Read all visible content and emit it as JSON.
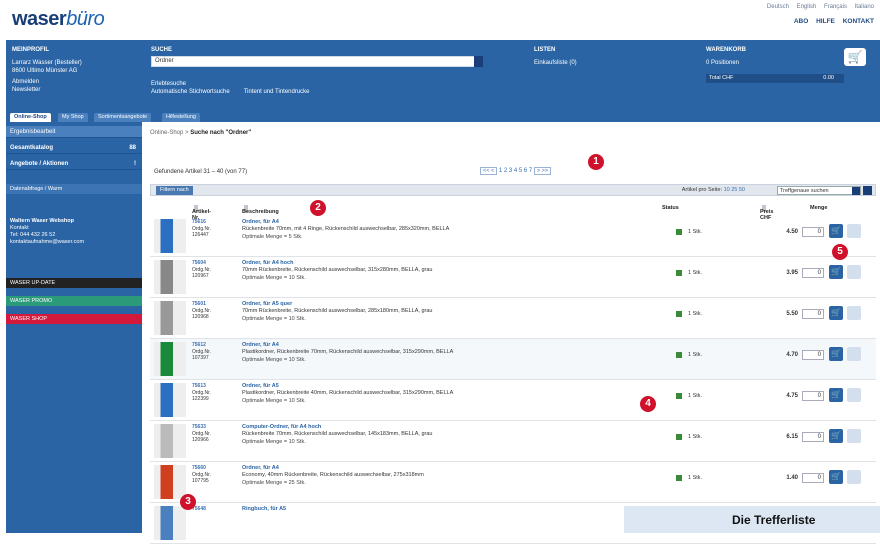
{
  "brand": {
    "logo_main": "waser",
    "logo_accent": "büro"
  },
  "top_links": [
    "Deutsch",
    "English",
    "Français",
    "Italiano"
  ],
  "top_nav": [
    "ABO",
    "HILFE",
    "KONTAKT"
  ],
  "banner": {
    "col1_title": "MEINPROFIL",
    "col1_lines": [
      "Larrarz Wasser (Besteller)",
      "8600 Ultimo Münster AG"
    ],
    "col1_links": [
      "Abmelden",
      "Newsletter"
    ],
    "search_title": "SUCHE",
    "search_value": "Ordner",
    "search_opts": [
      "Erlebtesuche",
      "Automatische Stichwortsuche",
      "Tintent und Tintendrucke"
    ],
    "lists_title": "LISTEN",
    "lists_item": "Einkaufsliste (0)",
    "cart_title": "WARENKORB",
    "cart_positions": "0 Positionen",
    "cart_total_label": "Total CHF",
    "cart_total_value": "0.00"
  },
  "tabs": [
    "Online-Shop",
    "My Shop",
    "Sortimentsangebote",
    "Hilfestellung"
  ],
  "sidebar": {
    "items": [
      {
        "label": "Ergebnisbearbeit",
        "right": ""
      },
      {
        "label": "Gesamtkatalog",
        "right": "88"
      },
      {
        "label": "Angebote / Aktionen",
        "right": "!"
      }
    ],
    "box1": "Datenabfrage / Warm",
    "contact_title": "Waltern Waser Webshop",
    "contact_lines": [
      "Kontakt",
      "Tel: 044 432 26 52",
      "kontaktaufnahme@waser.com"
    ],
    "bars": [
      {
        "label": "WASER UP-DATE",
        "color": "#222222"
      },
      {
        "label": "WASER PROMO",
        "color": "#2a9a78"
      },
      {
        "label": "WASER SHOP",
        "color": "#d41a3c"
      }
    ]
  },
  "breadcrumb": {
    "prefix": "Online-Shop >",
    "current": "Suche nach \"Ordner\""
  },
  "results": {
    "found": "Gefundene Artikel 31 – 40 (von 77)",
    "pages": "1 2 3 4 5 6 7",
    "per_page_label": "Artikel pro Seite:",
    "per_page_values": "10 25 50",
    "sort_value": "Treffgenaue suchen",
    "filter_button": "Filtern nach"
  },
  "columns": {
    "article": "Artikel-Nr.",
    "desc": "Beschreibung",
    "status": "Status",
    "price": "Preis CHF",
    "qty": "Menge"
  },
  "rows": [
    {
      "num": "75616",
      "unit": "Ordg.Nr.",
      "code": "126447",
      "title": "Ordner, für A4",
      "line": "Rückenbreite 70mm, mit 4 Ringe, Rückenschild auswechselbar, 285x320mm, BELLA",
      "min": "Optimale Menge = 5 Stk.",
      "stock": "1 Stk.",
      "price": "4.50",
      "qty": "0"
    },
    {
      "num": "75604",
      "unit": "Ordg.Nr.",
      "code": "120967",
      "title": "Ordner, für A4 hoch",
      "line": "70mm Rückenbreite, Rückenschild auswechselbar, 315x280mm, BELLA, grau",
      "min": "Optimale Menge = 10 Stk.",
      "stock": "1 Stk.",
      "price": "3.95",
      "qty": "0"
    },
    {
      "num": "75601",
      "unit": "Ordg.Nr.",
      "code": "120968",
      "title": "Ordner, für A5 quer",
      "line": "70mm Rückenbreite, Rückenschild auswechselbar, 285x180mm, BELLA, grau",
      "min": "Optimale Menge = 10 Stk.",
      "stock": "1 Stk.",
      "price": "5.50",
      "qty": "0"
    },
    {
      "num": "75612",
      "unit": "Ordg.Nr.",
      "code": "107397",
      "title": "Ordner, für A4",
      "line": "Plastikordner, Rückenbreite 70mm, Rückenschild auswechselbar, 315x290mm, BELLA",
      "min": "Optimale Menge = 10 Stk.",
      "stock": "1 Stk.",
      "price": "4.70",
      "qty": "0"
    },
    {
      "num": "75613",
      "unit": "Ordg.Nr.",
      "code": "122399",
      "title": "Ordner, für A5",
      "line": "Plastikordner, Rückenbreite 40mm, Rückenschild auswechselbar, 315x290mm, BELLA",
      "min": "Optimale Menge = 10 Stk.",
      "stock": "1 Stk.",
      "price": "4.75",
      "qty": "0"
    },
    {
      "num": "75633",
      "unit": "Ordg.Nr.",
      "code": "120966",
      "title": "Computer-Ordner, für A4 hoch",
      "line": "Rückenbreite 70mm, Rückenschild auswechselbar, 145x183mm, BELLA, grau",
      "min": "Optimale Menge = 10 Stk.",
      "stock": "1 Stk.",
      "price": "6.15",
      "qty": "0"
    },
    {
      "num": "75660",
      "unit": "Ordg.Nr.",
      "code": "107795",
      "title": "Ordner, für A4",
      "line": "Economy, 40mm Rückenbreite, Rückenschild auswechselbar, 275x318mm",
      "min": "Optimale Menge = 25 Stk.",
      "stock": "1 Stk.",
      "price": "1.40",
      "qty": "0"
    },
    {
      "num": "75648",
      "unit": "",
      "code": "",
      "title": "Ringbuch, für A5",
      "line": "",
      "min": "",
      "stock": "",
      "price": "",
      "qty": ""
    }
  ],
  "badges": [
    "1",
    "2",
    "3",
    "4",
    "5"
  ],
  "caption": "Die Trefferliste"
}
